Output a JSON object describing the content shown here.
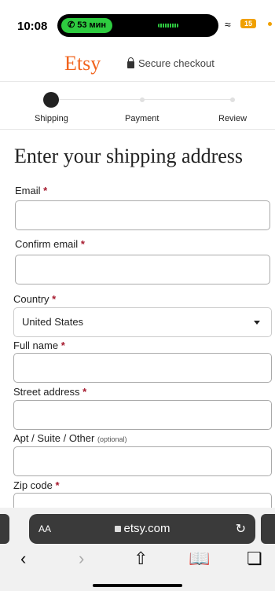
{
  "status_bar": {
    "time": "10:08",
    "call_duration": "53 мин",
    "battery": "15"
  },
  "header": {
    "logo": "Etsy",
    "secure_checkout": "Secure checkout",
    "brand_color": "#f1641e"
  },
  "steps": [
    {
      "label": "Shipping",
      "active": true
    },
    {
      "label": "Payment",
      "active": false
    },
    {
      "label": "Review",
      "active": false
    }
  ],
  "form": {
    "title": "Enter your shipping address",
    "fields": {
      "email": {
        "label": "Email",
        "required": "*",
        "value": ""
      },
      "confirm_email": {
        "label": "Confirm email",
        "required": "*",
        "value": ""
      },
      "country": {
        "label": "Country",
        "required": "*",
        "value": "United States"
      },
      "full_name": {
        "label": "Full name",
        "required": "*",
        "value": ""
      },
      "street": {
        "label": "Street address",
        "required": "*",
        "value": ""
      },
      "apt": {
        "label": "Apt / Suite / Other",
        "optional": "(optional)",
        "value": ""
      },
      "zip": {
        "label": "Zip code",
        "required": "*",
        "value": ""
      }
    }
  },
  "browser": {
    "text_size": "AA",
    "url": "etsy.com"
  },
  "icons": [
    "phone-icon",
    "wifi-icon",
    "battery-icon",
    "lock-icon",
    "dropdown-caret-icon",
    "reload-icon",
    "back-icon",
    "forward-icon",
    "share-icon",
    "bookmarks-icon",
    "tabs-icon"
  ]
}
